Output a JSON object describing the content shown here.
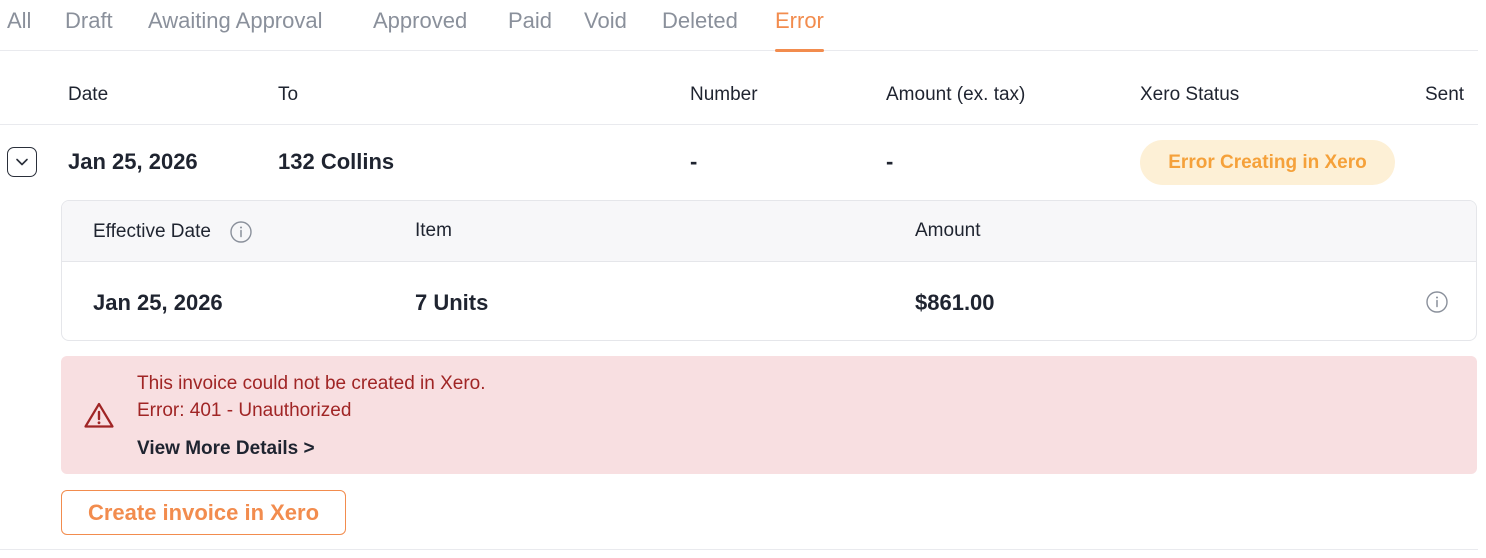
{
  "tabs": [
    {
      "label": "All",
      "active": false
    },
    {
      "label": "Draft",
      "active": false
    },
    {
      "label": "Awaiting Approval",
      "active": false
    },
    {
      "label": "Approved",
      "active": false
    },
    {
      "label": "Paid",
      "active": false
    },
    {
      "label": "Void",
      "active": false
    },
    {
      "label": "Deleted",
      "active": false
    },
    {
      "label": "Error",
      "active": true
    }
  ],
  "table": {
    "headers": {
      "date": "Date",
      "to": "To",
      "number": "Number",
      "amount": "Amount (ex. tax)",
      "xero_status": "Xero Status",
      "sent": "Sent"
    },
    "row": {
      "date": "Jan 25, 2026",
      "to": "132 Collins",
      "number": "-",
      "amount": "-",
      "xero_status": "Error Creating in Xero",
      "toggle_icon": "chevron-down-icon"
    }
  },
  "line_items": {
    "headers": {
      "effective_date": "Effective Date",
      "item": "Item",
      "amount": "Amount"
    },
    "rows": [
      {
        "effective_date": "Jan 25, 2026",
        "item": "7 Units",
        "amount": "$861.00"
      }
    ]
  },
  "error_alert": {
    "icon": "warning-triangle-icon",
    "message": "This invoice could not be created in Xero.",
    "detail": "Error: 401 - Unauthorized",
    "link": "View More Details >"
  },
  "actions": {
    "create_invoice": "Create invoice in Xero"
  },
  "colors": {
    "accent": "#f28c4e",
    "badge_bg": "#fdf0d6",
    "badge_text": "#f5a13a",
    "error_bg": "#f8dfe1",
    "error_text": "#a02525"
  }
}
